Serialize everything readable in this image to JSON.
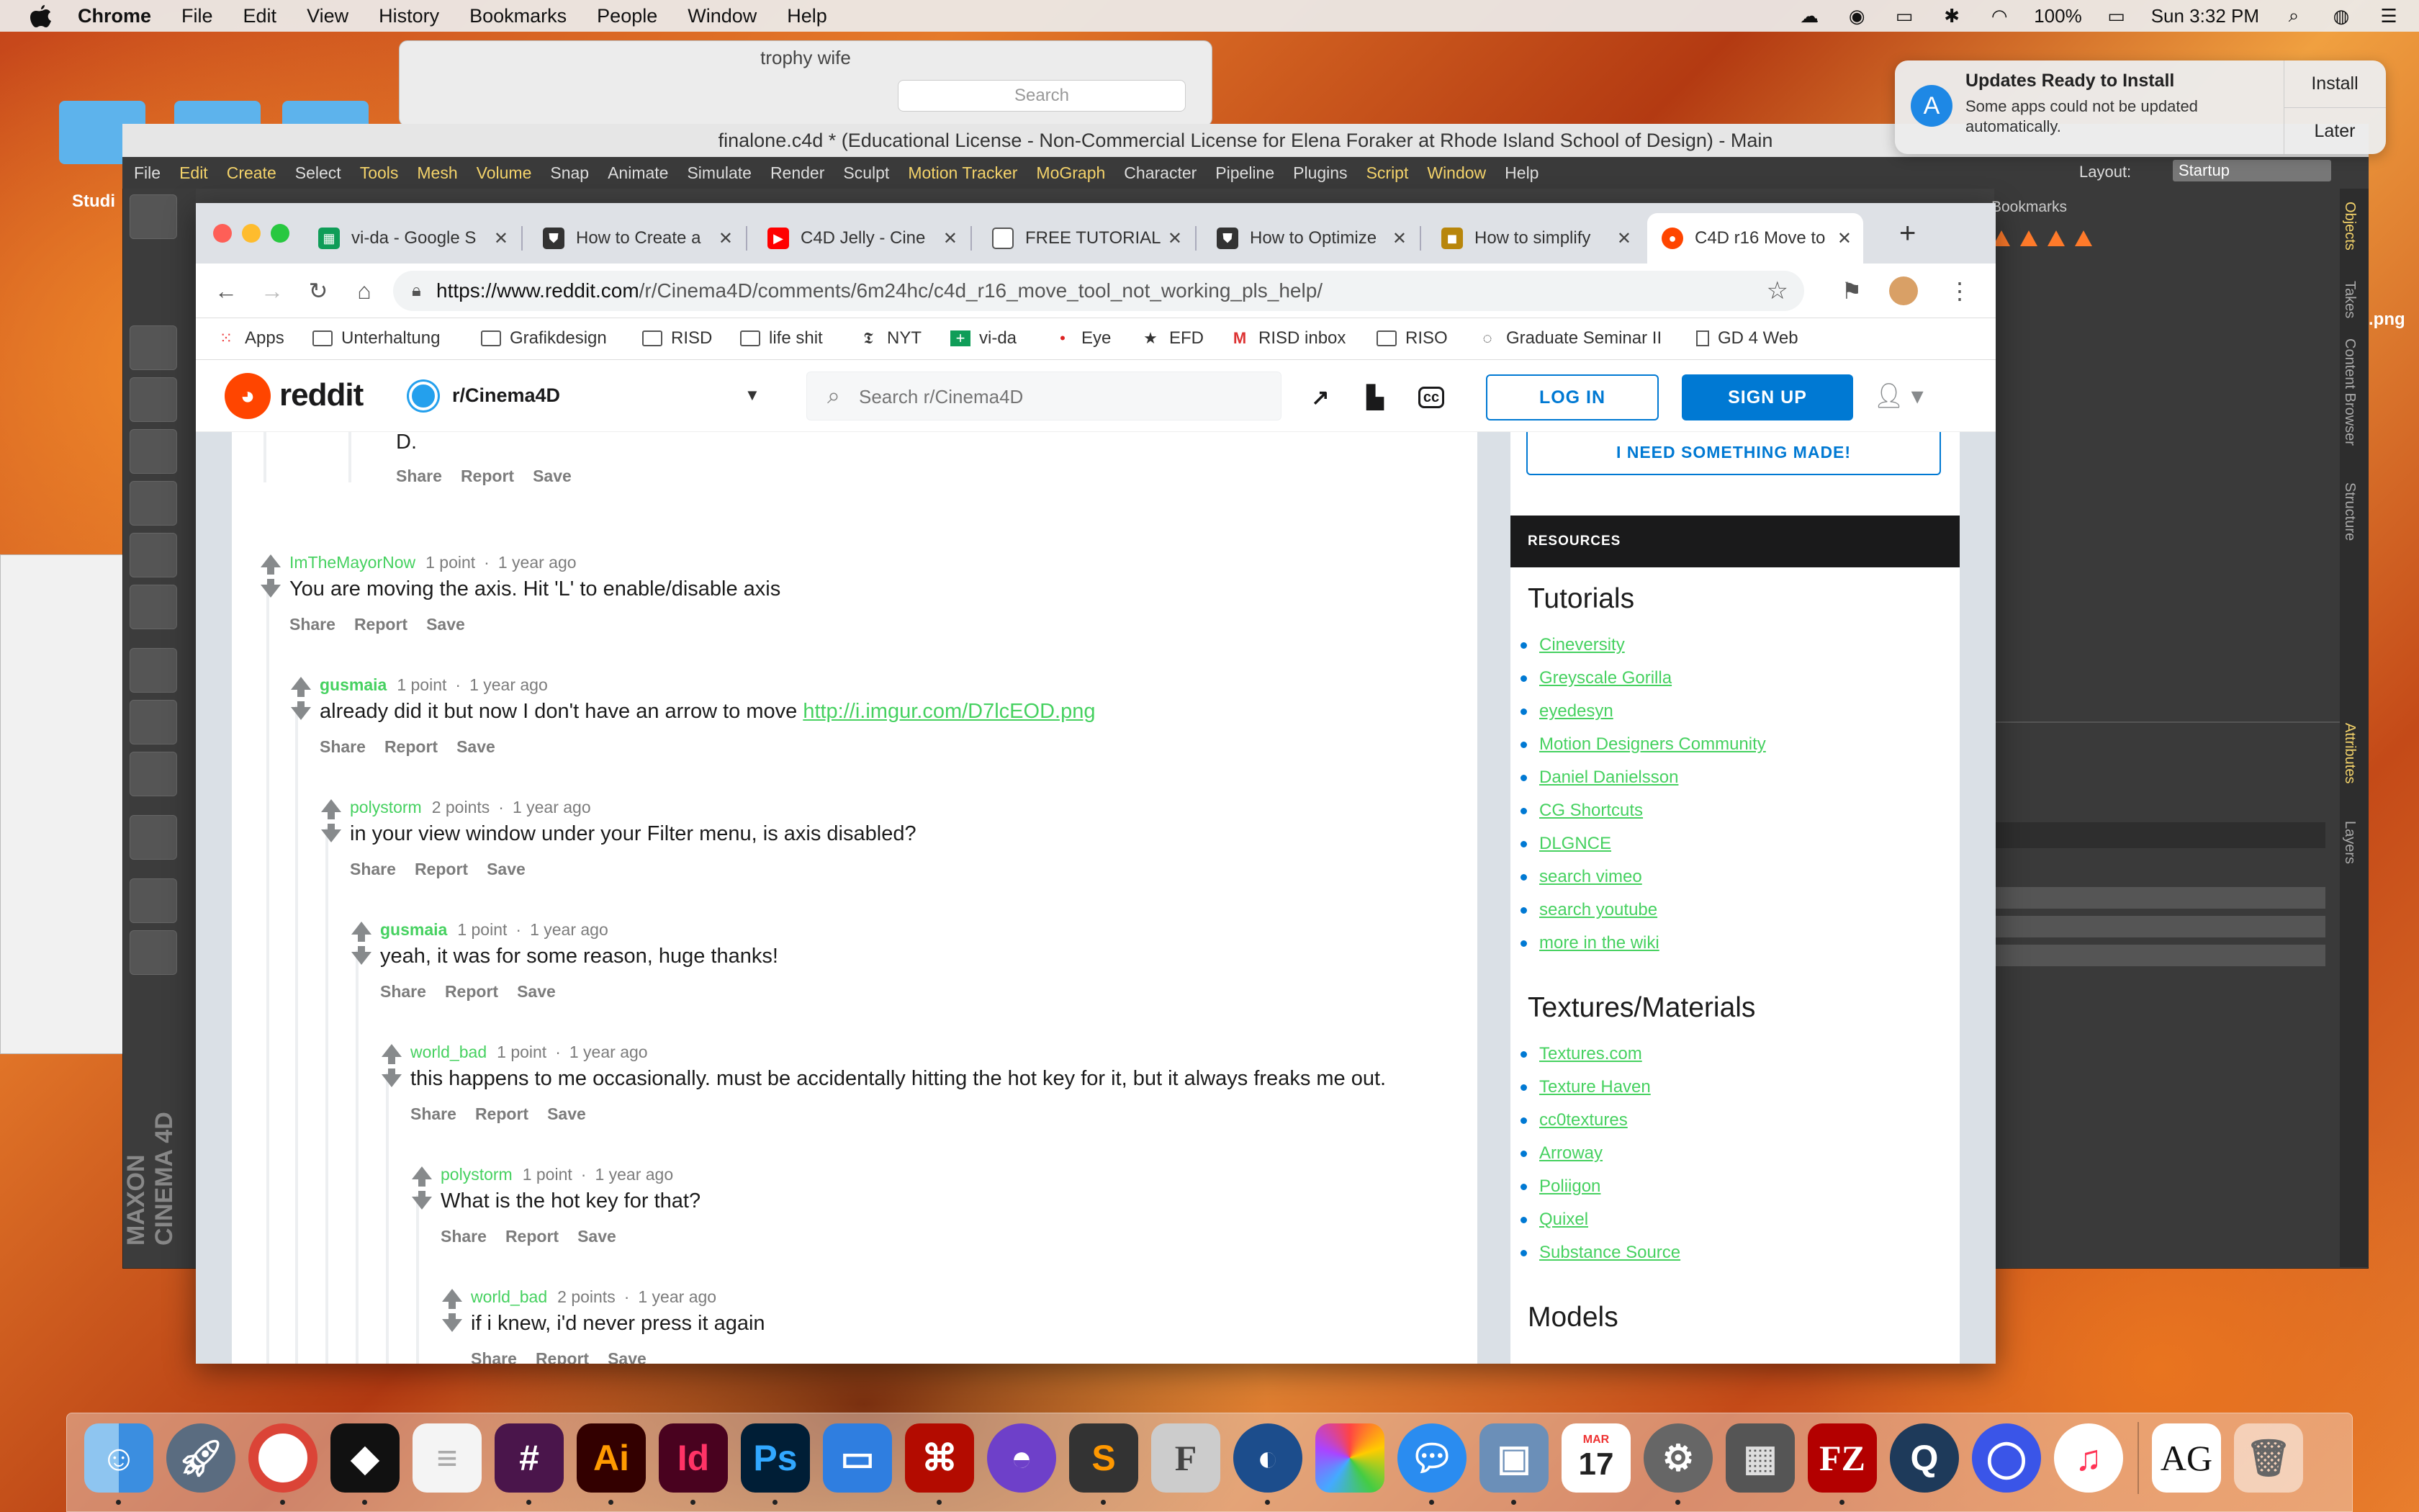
{
  "menubar": {
    "app": "Chrome",
    "items": [
      "File",
      "Edit",
      "View",
      "History",
      "Bookmarks",
      "People",
      "Window",
      "Help"
    ],
    "battery": "100%",
    "clock": "Sun 3:32 PM"
  },
  "desktop": {
    "folder_label": "Studi",
    "png_label": ".png",
    "preview_title": "trophy wife",
    "preview_search": "Search"
  },
  "notification": {
    "title": "Updates Ready to Install",
    "body": "Some apps could not be updated automatically.",
    "install": "Install",
    "later": "Later"
  },
  "c4d": {
    "title": "finalone.c4d * (Educational License - Non-Commercial License for Elena Foraker at Rhode Island School of Design) - Main",
    "menu": [
      "File",
      "Edit",
      "Create",
      "Select",
      "Tools",
      "Mesh",
      "Volume",
      "Snap",
      "Animate",
      "Simulate",
      "Render",
      "Sculpt",
      "Motion Tracker",
      "MoGraph",
      "Character",
      "Pipeline",
      "Plugins",
      "Script",
      "Window",
      "Help"
    ],
    "layout_label": "Layout:",
    "layout_value": "Startup",
    "bookmarks": "Bookmarks",
    "side_tabs": [
      "Objects",
      "Takes",
      "Content Browser",
      "Structure",
      "Attributes",
      "Layers"
    ],
    "brand_a": "MAXON",
    "brand_b": "CINEMA 4D"
  },
  "browser": {
    "tabs": [
      {
        "title": "vi-da - Google S",
        "icon": "sheets"
      },
      {
        "title": "How to Create a",
        "icon": "shield"
      },
      {
        "title": "C4D Jelly - Cine",
        "icon": "youtube"
      },
      {
        "title": "FREE TUTORIAL",
        "icon": "doc"
      },
      {
        "title": "How to Optimize",
        "icon": "shield"
      },
      {
        "title": "How to simplify",
        "icon": "site"
      },
      {
        "title": "C4D r16 Move to",
        "icon": "reddit"
      }
    ],
    "url_host": "https://www.reddit.com",
    "url_path": "/r/Cinema4D/comments/6m24hc/c4d_r16_move_tool_not_working_pls_help/",
    "bookmarks": [
      "Apps",
      "Unterhaltung",
      "Grafikdesign",
      "RISD",
      "life shit",
      "NYT",
      "vi-da",
      "Eye",
      "EFD",
      "RISD inbox",
      "RISO",
      "Graduate Seminar II",
      "GD 4 Web"
    ]
  },
  "reddit": {
    "logo": "reddit",
    "subreddit": "r/Cinema4D",
    "search_placeholder": "Search r/Cinema4D",
    "login": "LOG IN",
    "signup": "SIGN UP",
    "actions": {
      "share": "Share",
      "report": "Report",
      "save": "Save"
    },
    "top_fragment": "D.",
    "comments": [
      {
        "author": "ImTheMayorNow",
        "points": "1 point",
        "age": "1 year ago",
        "text": "You are moving the axis. Hit 'L' to enable/disable axis",
        "link": ""
      },
      {
        "author": "gusmaia",
        "points": "1 point",
        "age": "1 year ago",
        "text": "already did it but now I don't have an arrow to move ",
        "link": "http://i.imgur.com/D7lcEOD.png"
      },
      {
        "author": "polystorm",
        "points": "2 points",
        "age": "1 year ago",
        "text": "in your view window under your Filter menu, is axis disabled?",
        "link": ""
      },
      {
        "author": "gusmaia",
        "points": "1 point",
        "age": "1 year ago",
        "text": "yeah, it was for some reason, huge thanks!",
        "link": ""
      },
      {
        "author": "world_bad",
        "points": "1 point",
        "age": "1 year ago",
        "text": "this happens to me occasionally. must be accidentally hitting the hot key for it, but it always freaks me out.",
        "link": ""
      },
      {
        "author": "polystorm",
        "points": "1 point",
        "age": "1 year ago",
        "text": "What is the hot key for that?",
        "link": ""
      },
      {
        "author": "world_bad",
        "points": "2 points",
        "age": "1 year ago",
        "text": "if i knew, i'd never press it again",
        "link": ""
      }
    ],
    "sidebar": {
      "need_button": "I NEED SOMETHING MADE!",
      "resources": "RESOURCES",
      "tutorials_heading": "Tutorials",
      "tutorials": [
        "Cineversity",
        "Greyscale Gorilla",
        "eyedesyn",
        "Motion Designers Community",
        "Daniel Danielsson",
        "CG Shortcuts",
        "DLGNCE",
        "search vimeo",
        "search youtube",
        "more in the wiki"
      ],
      "textures_heading": "Textures/Materials",
      "textures": [
        "Textures.com",
        "Texture Haven",
        "cc0textures",
        "Arroway",
        "Poliigon",
        "Quixel",
        "Substance Source"
      ],
      "models_heading": "Models"
    }
  },
  "dock": {
    "ai": "Ai",
    "id": "Id",
    "ps": "Ps",
    "cal_month": "MAR",
    "cal_day": "17",
    "fz": "FZ",
    "ag": "AG"
  },
  "colors": {
    "reddit_orange": "#ff4500",
    "reddit_blue": "#0079d3",
    "link_green": "#46d160"
  }
}
